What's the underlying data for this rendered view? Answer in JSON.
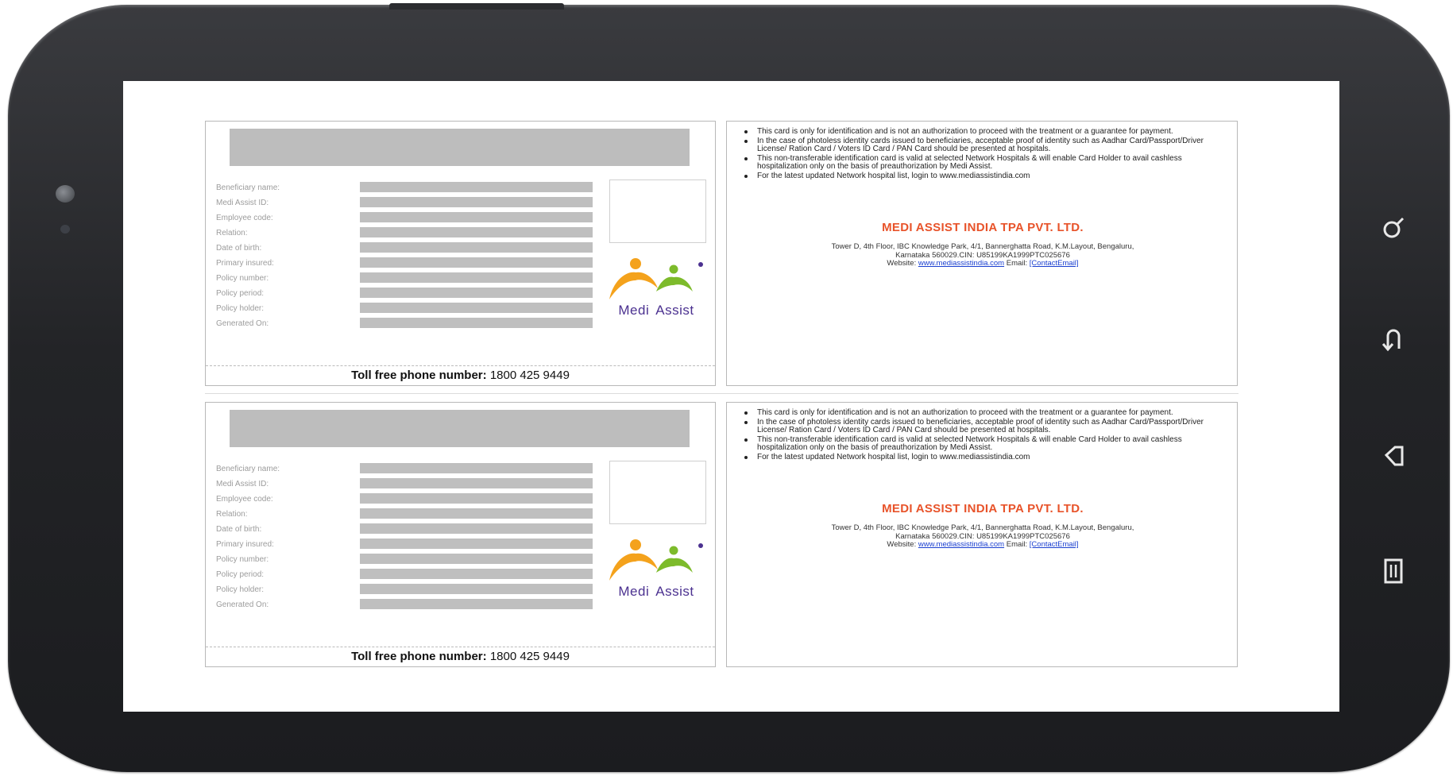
{
  "device": {
    "nav_buttons": [
      "search-icon",
      "back-icon",
      "home-icon",
      "menu-icon"
    ]
  },
  "cards": [
    {
      "fields": [
        "Beneficiary name:",
        "Medi Assist ID:",
        "Employee code:",
        "Relation:",
        "Date of birth:",
        "Primary insured:",
        "Policy number:",
        "Policy period:",
        "Policy holder:",
        "Generated On:"
      ],
      "logo": {
        "word1": "Medi",
        "word2": "Assist"
      },
      "tollfree": {
        "label": "Toll free phone number:",
        "number": "1800 425 9449"
      },
      "terms": [
        "This card is only for identification and is not an authorization to proceed with the treatment or a guarantee for payment.",
        "In the case of photoless identity cards issued to beneficiaries, acceptable proof of identity such as Aadhar Card/Passport/Driver License/ Ration Card / Voters ID Card / PAN Card should be presented at hospitals.",
        "This non-transferable identification card is valid at selected Network Hospitals & will enable Card Holder to avail cashless hospitalization only on the basis of preauthorization by Medi Assist.",
        "For the latest updated Network hospital list, login to www.mediassistindia.com"
      ],
      "company": "MEDI ASSIST INDIA TPA PVT. LTD.",
      "address_line1": "Tower D, 4th Floor, IBC Knowledge Park, 4/1, Bannerghatta Road, K.M.Layout, Bengaluru,",
      "address_line2": "Karnataka 560029.CIN: U85199KA1999PTC025676",
      "website_label": "Website:",
      "website": "www.mediassistindia.com",
      "email_label": "Email:",
      "email": "[ContactEmail]"
    },
    {
      "fields": [
        "Beneficiary name:",
        "Medi Assist ID:",
        "Employee code:",
        "Relation:",
        "Date of birth:",
        "Primary insured:",
        "Policy number:",
        "Policy period:",
        "Policy holder:",
        "Generated On:"
      ],
      "logo": {
        "word1": "Medi",
        "word2": "Assist"
      },
      "tollfree": {
        "label": "Toll free phone number:",
        "number": "1800 425 9449"
      },
      "terms": [
        "This card is only for identification and is not an authorization to proceed with the treatment or a guarantee for payment.",
        "In the case of photoless identity cards issued to beneficiaries, acceptable proof of identity such as Aadhar Card/Passport/Driver License/ Ration Card / Voters ID Card / PAN Card should be presented at hospitals.",
        "This non-transferable identification card is valid at selected Network Hospitals & will enable Card Holder to avail cashless hospitalization only on the basis of preauthorization by Medi Assist.",
        "For the latest updated Network hospital list, login to www.mediassistindia.com"
      ],
      "company": "MEDI ASSIST INDIA TPA PVT. LTD.",
      "address_line1": "Tower D, 4th Floor, IBC Knowledge Park, 4/1, Bannerghatta Road, K.M.Layout, Bengaluru,",
      "address_line2": "Karnataka 560029.CIN: U85199KA1999PTC025676",
      "website_label": "Website:",
      "website": "www.mediassistindia.com",
      "email_label": "Email:",
      "email": "[ContactEmail]"
    }
  ],
  "colors": {
    "company": "#e8532a",
    "logo_text": "#4b3190",
    "logo_orange": "#f4a21c",
    "logo_green": "#7dbb2b",
    "link": "#1a3fd0"
  }
}
